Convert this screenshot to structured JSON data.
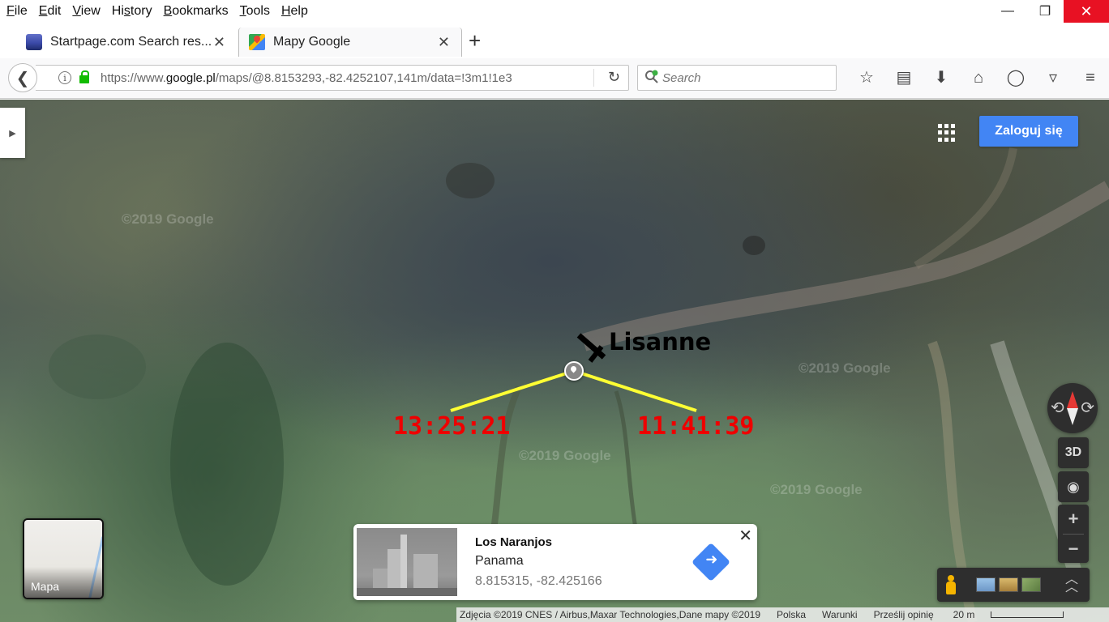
{
  "menu": {
    "items": [
      {
        "pre": "",
        "key": "F",
        "post": "ile"
      },
      {
        "pre": "",
        "key": "E",
        "post": "dit"
      },
      {
        "pre": "",
        "key": "V",
        "post": "iew"
      },
      {
        "pre": "Hi",
        "key": "s",
        "post": "tory"
      },
      {
        "pre": "",
        "key": "B",
        "post": "ookmarks"
      },
      {
        "pre": "",
        "key": "T",
        "post": "ools"
      },
      {
        "pre": "",
        "key": "H",
        "post": "elp"
      }
    ]
  },
  "window_controls": {
    "minimize": "—",
    "maximize": "❐",
    "close": "✕"
  },
  "tabs": [
    {
      "title": "Startpage.com Search res...",
      "close": "✕"
    },
    {
      "title": "Mapy Google",
      "close": "✕"
    }
  ],
  "new_tab": "+",
  "nav": {
    "back": "❮",
    "url_prefix": "https://www.",
    "url_domain": "google.pl",
    "url_path": "/maps/@8.8153293,-82.4252107,141m/data=!3m1!1e3",
    "reload": "↻",
    "search_placeholder": "Search",
    "toolbar_icons": [
      "☆",
      "▤",
      "⬇",
      "⌂",
      "◯",
      "▿",
      "≡"
    ]
  },
  "map": {
    "sign_in": "Zaloguj się",
    "watermark": "©2019 Google",
    "annotations": {
      "name": "Lisanne",
      "time_left": "13:25:21",
      "time_right": "11:41:39",
      "line_color": "#ffff33",
      "time_color": "#e00000"
    },
    "controls": {
      "btn_3d": "3D",
      "locate": "◉",
      "zoom_in": "+",
      "zoom_out": "−",
      "expand": "︿"
    },
    "minimap_label": "Mapa",
    "place": {
      "name": "Los Naranjos",
      "country": "Panama",
      "coords": "8.815315, -82.425166",
      "close": "✕"
    },
    "footer": {
      "attribution": "Zdjęcia ©2019 CNES / Airbus,Maxar Technologies,Dane mapy ©2019",
      "country": "Polska",
      "terms": "Warunki",
      "feedback": "Prześlij opinię",
      "scale": "20 m"
    }
  }
}
